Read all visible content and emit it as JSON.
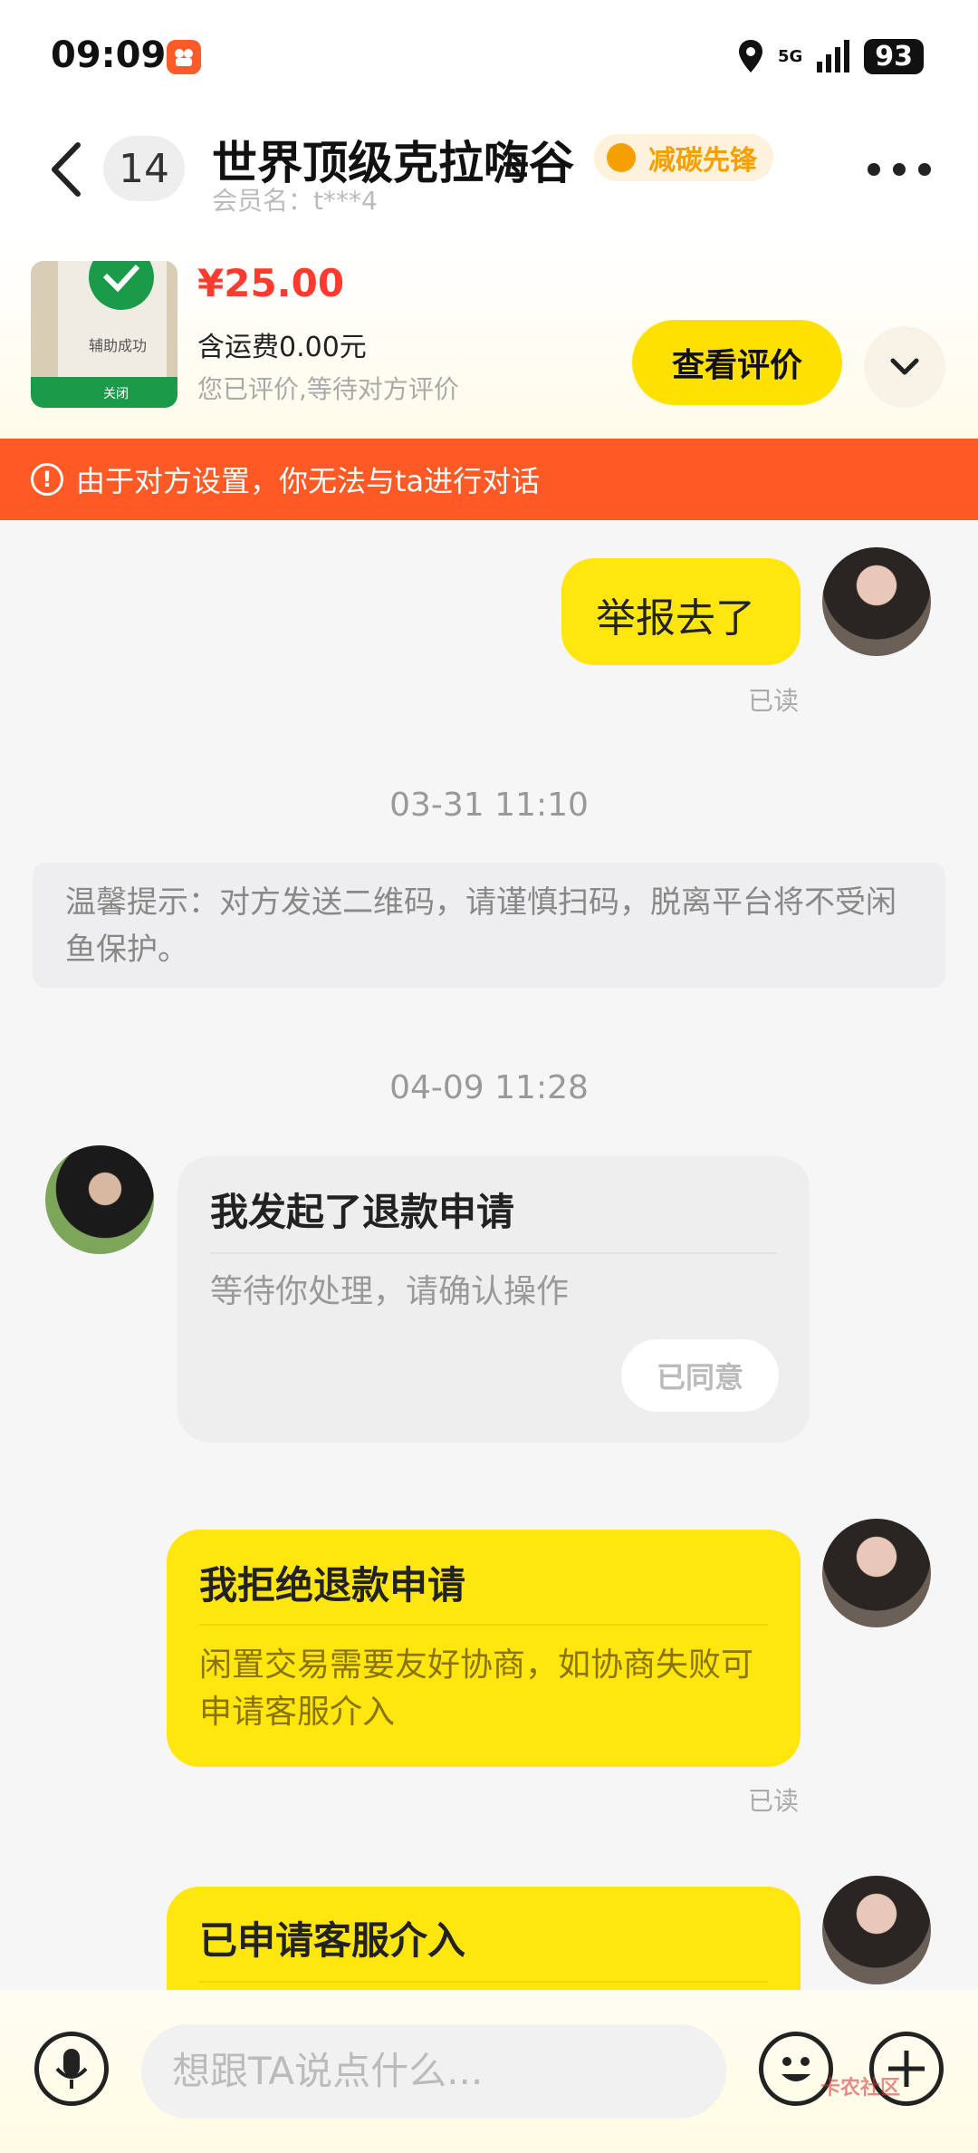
{
  "status_bar": {
    "time": "09:09",
    "network": "5G",
    "battery": "93"
  },
  "header": {
    "unread_count": "14",
    "title": "世界顶级克拉嗨谷",
    "tag": "减碳先锋",
    "member": "会员名：t***4"
  },
  "product": {
    "thumb_text_top": "辅助成功",
    "thumb_text_bottom": "关闭",
    "price": "¥25.00",
    "shipping": "含运费0.00元",
    "eval_status": "您已评价,等待对方评价",
    "view_review_label": "查看评价"
  },
  "banner": {
    "icon": "!",
    "text": "由于对方设置，你无法与ta进行对话"
  },
  "messages": {
    "msg1": {
      "text": "举报去了",
      "read": "已读"
    },
    "ts1": "03-31 11:10",
    "notice": "温馨提示：对方发送二维码，请谨慎扫码，脱离平台将不受闲鱼保护。",
    "ts2": "04-09 11:28",
    "card1": {
      "title": "我发起了退款申请",
      "body": "等待你处理，请确认操作",
      "button": "已同意"
    },
    "card2": {
      "title": "我拒绝退款申请",
      "body": "闲置交易需要友好协商，如协商失败可申请客服介入",
      "read": "已读"
    },
    "card3": {
      "title": "已申请客服介入"
    }
  },
  "input": {
    "placeholder": "想跟TA说点什么..."
  },
  "watermark": "卡农社区",
  "colors": {
    "accent_yellow": "#ffe60f",
    "banner_orange": "#ff5a26",
    "price_red": "#ff3b30"
  }
}
